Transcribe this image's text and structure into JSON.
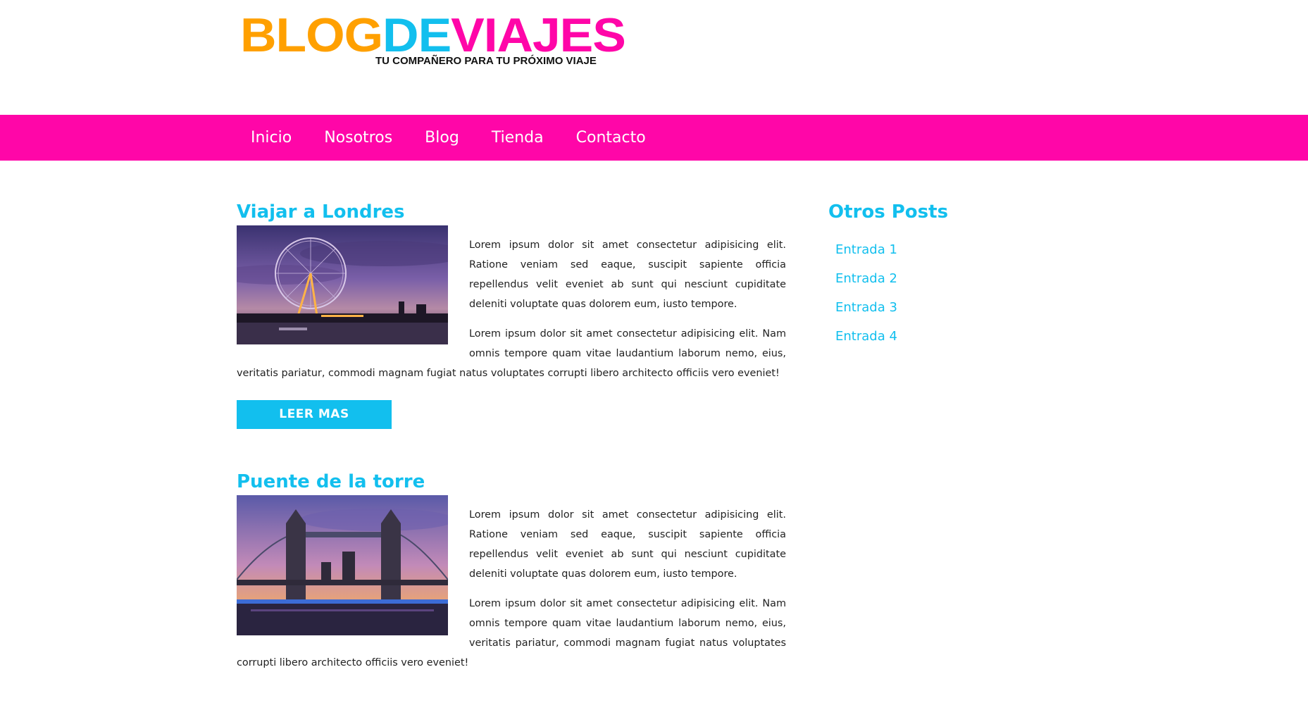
{
  "logo": {
    "part1": "BLOG",
    "part2": "DE",
    "part3": "VIAJES",
    "tagline": "TU COMPAÑERO PARA TU PRÓXIMO VIAJE"
  },
  "nav": {
    "items": [
      "Inicio",
      "Nosotros",
      "Blog",
      "Tienda",
      "Contacto"
    ]
  },
  "posts": [
    {
      "title": "Viajar a Londres",
      "image": "london-eye-sunset-image",
      "p1": "Lorem ipsum dolor sit amet consectetur adipisicing elit. Ratione veniam sed eaque, suscipit sapiente officia repellendus velit eveniet ab sunt qui nesciunt cupiditate deleniti voluptate quas dolorem eum, iusto tempore.",
      "p2": "Lorem ipsum dolor sit amet consectetur adipisicing elit. Nam omnis tempore quam vitae laudantium laborum nemo, eius, veritatis pariatur, commodi magnam fugiat natus voluptates corrupti libero architecto officiis vero eveniet!",
      "button": "LEER MAS"
    },
    {
      "title": "Puente de la torre",
      "image": "tower-bridge-sunset-image",
      "p1": "Lorem ipsum dolor sit amet consectetur adipisicing elit. Ratione veniam sed eaque, suscipit sapiente officia repellendus velit eveniet ab sunt qui nesciunt cupiditate deleniti voluptate quas dolorem eum, iusto tempore.",
      "p2": "Lorem ipsum dolor sit amet consectetur adipisicing elit. Nam omnis tempore quam vitae laudantium laborum nemo, eius, veritatis pariatur, commodi magnam fugiat natus voluptates corrupti libero architecto officiis vero eveniet!"
    }
  ],
  "sidebar": {
    "title": "Otros Posts",
    "items": [
      "Entrada 1",
      "Entrada 2",
      "Entrada 3",
      "Entrada 4"
    ]
  },
  "colors": {
    "pink": "#ff06a8",
    "cyan": "#12bfee",
    "orange": "#ffa000"
  }
}
